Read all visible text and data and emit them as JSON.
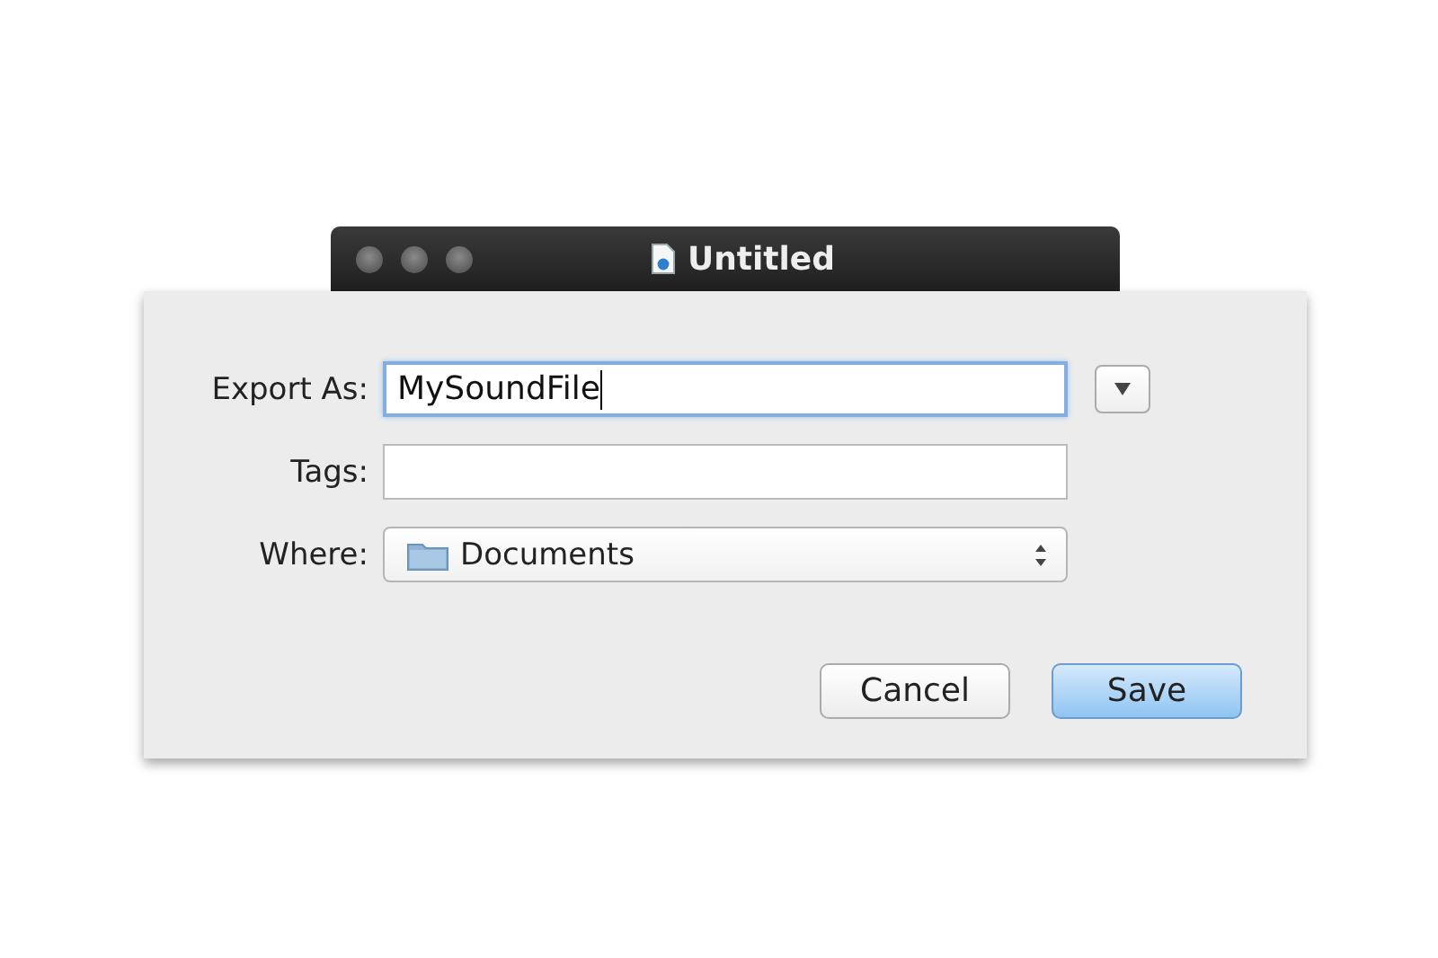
{
  "window": {
    "title": "Untitled"
  },
  "fields": [
    {
      "kind": "text",
      "label": "Export As:",
      "value": "MySoundFile",
      "focused": true
    },
    {
      "kind": "text",
      "label": "Tags:",
      "focused": false
    },
    {
      "kind": "popup",
      "label": "Where:",
      "value": "Documents"
    }
  ],
  "buttons": [
    {
      "label": "Cancel",
      "default": false
    },
    {
      "label": "Save",
      "default": true
    }
  ]
}
